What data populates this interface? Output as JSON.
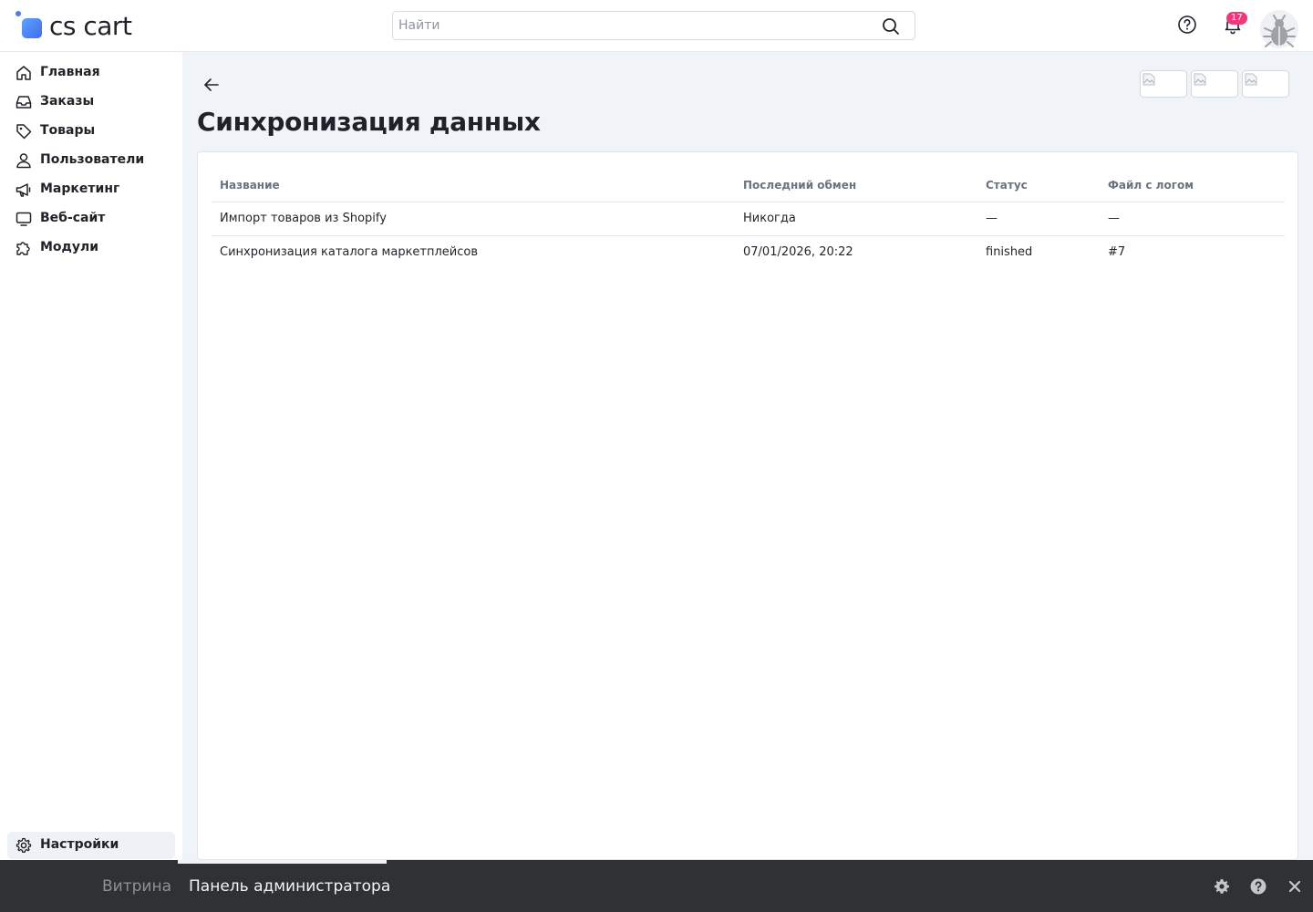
{
  "header": {
    "logo_text": "cs cart",
    "search_placeholder": "Найти",
    "notifications_count": "17"
  },
  "sidebar": {
    "items": [
      {
        "label": "Главная",
        "icon": "home-icon"
      },
      {
        "label": "Заказы",
        "icon": "inbox-icon"
      },
      {
        "label": "Товары",
        "icon": "tag-icon"
      },
      {
        "label": "Пользователи",
        "icon": "user-icon"
      },
      {
        "label": "Маркетинг",
        "icon": "megaphone-icon"
      },
      {
        "label": "Веб-сайт",
        "icon": "monitor-icon"
      },
      {
        "label": "Модули",
        "icon": "puzzle-icon"
      }
    ],
    "settings_label": "Настройки"
  },
  "main": {
    "title": "Синхронизация данных",
    "table": {
      "columns": [
        "Название",
        "Последний обмен",
        "Статус",
        "Файл с логом"
      ],
      "rows": [
        {
          "name": "Импорт товаров из Shopify",
          "last_exchange": "Никогда",
          "status": "—",
          "log_file": "—"
        },
        {
          "name": "Синхронизация каталога маркетплейсов",
          "last_exchange": "07/01/2026, 20:22",
          "status": "finished",
          "log_file": "#7"
        }
      ]
    }
  },
  "bottom_bar": {
    "storefront_label": "Витрина",
    "admin_label": "Панель администратора"
  },
  "colors": {
    "accent": "#4a7df5",
    "badge": "#f0397a",
    "page_bg": "#f0f3f8",
    "bottom_bar": "#2f3133"
  }
}
